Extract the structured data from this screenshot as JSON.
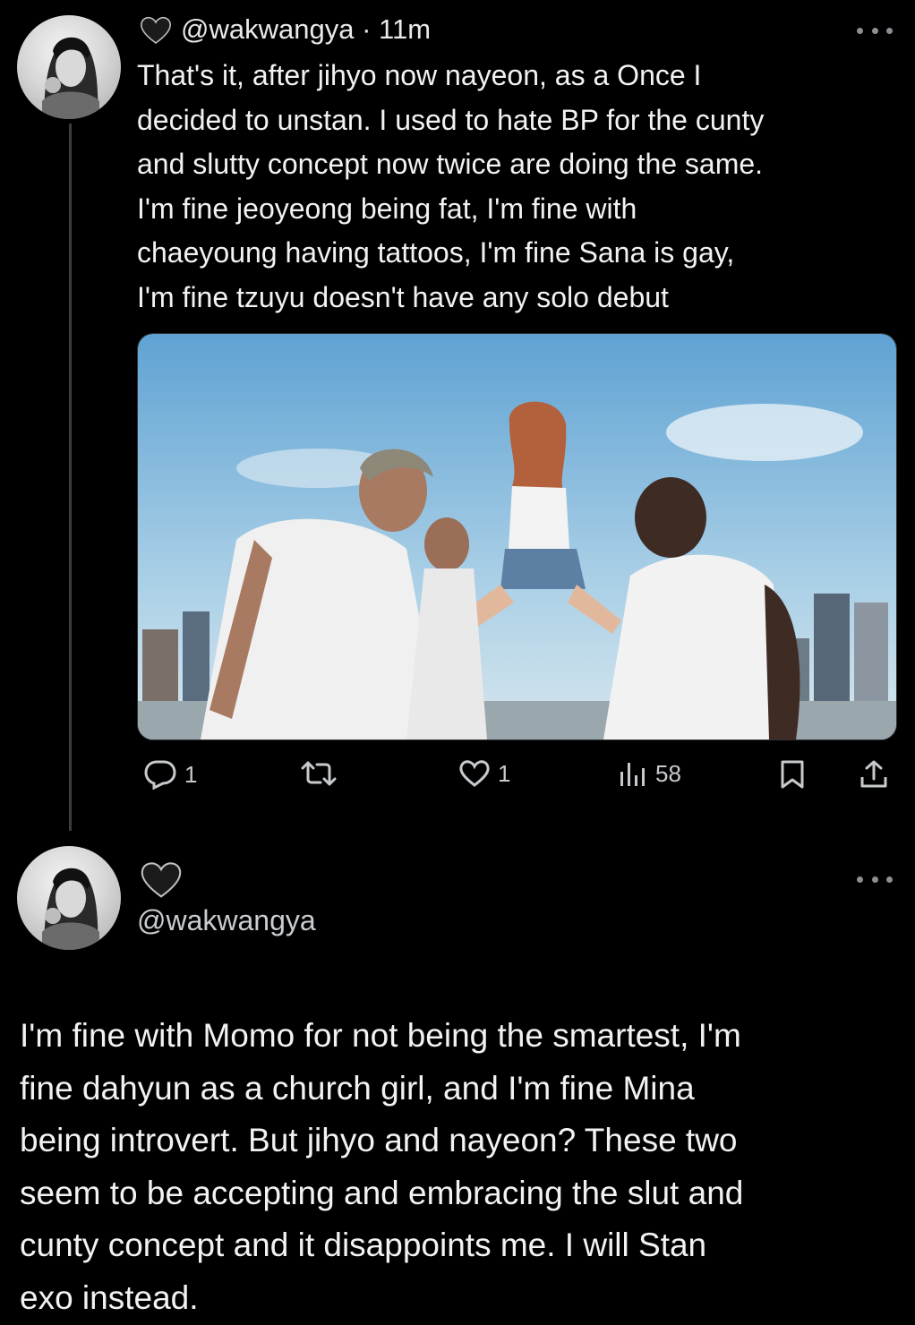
{
  "tweet1": {
    "handle": "@wakwangya",
    "time": "· 11m",
    "text": "That's it, after jihyo now nayeon, as a Once I\ndecided to unstan. I used to hate BP for the cunty\nand slutty concept now twice are doing the same.\nI'm fine jeoyeong being fat, I'm fine with\nchaeyoung having tattoos, I'm fine Sana is gay,\nI'm fine tzuyu doesn't have any solo debut",
    "actions": {
      "replies": "1",
      "reposts": "",
      "likes": "1",
      "views": "58"
    },
    "icons": [
      "black-heart-icon",
      "more-icon",
      "reply-icon",
      "repost-icon",
      "like-icon",
      "views-icon",
      "bookmark-icon",
      "share-icon"
    ]
  },
  "tweet2": {
    "handle": "@wakwangya",
    "text": "I'm fine with Momo for not being the smartest, I'm\nfine dahyun as a church girl, and I'm fine Mina\nbeing introvert. But jihyo and nayeon? These two\nseem to be accepting and embracing the slut and\ncunty concept and it disappoints me. I will Stan\nexo instead."
  },
  "colors": {
    "background": "#000000",
    "text": "#e7e9ea",
    "secondary": "#8b9096",
    "thread_line": "#3a3d41"
  }
}
